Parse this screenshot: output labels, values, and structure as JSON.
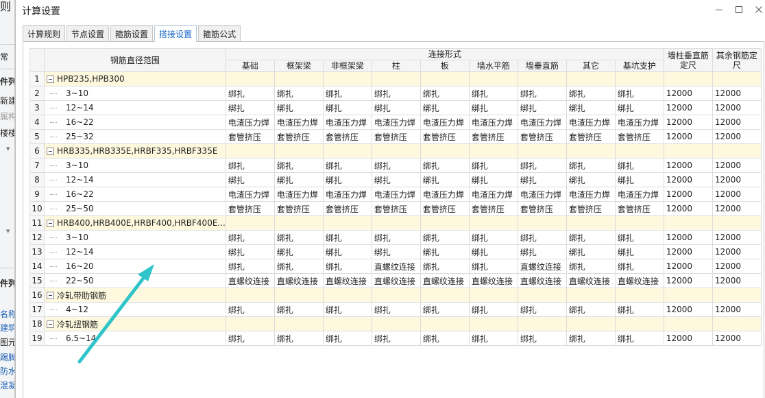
{
  "background_app": {
    "fragments": [
      "则",
      "常",
      "件列",
      "新建",
      "属构件",
      "楼楼",
      "件列",
      "名称",
      "建筑",
      "图元",
      "踢脚",
      "防水",
      "混凝"
    ]
  },
  "dialog": {
    "title": "计算设置",
    "tabs": [
      "计算规则",
      "节点设置",
      "箍筋设置",
      "搭接设置",
      "箍筋公式"
    ],
    "active_tab": "搭接设置"
  },
  "grid": {
    "header": {
      "range_col": "钢筋直径范围",
      "group_header": "连接形式",
      "sub_cols": [
        "基础",
        "框架梁",
        "非框架梁",
        "柱",
        "板",
        "墙水平筋",
        "墙垂直筋",
        "其它",
        "基坑支护"
      ],
      "wall_length": "墙柱垂直筋定尺",
      "other_length": "其余钢筋定尺"
    },
    "rows": [
      {
        "n": "1",
        "type": "group",
        "label": "HPB235,HPB300",
        "cells": [
          "",
          "",
          "",
          "",
          "",
          "",
          "",
          "",
          ""
        ],
        "l1": "",
        "l2": ""
      },
      {
        "n": "2",
        "type": "child",
        "label": "3~10",
        "cells": [
          "绑扎",
          "绑扎",
          "绑扎",
          "绑扎",
          "绑扎",
          "绑扎",
          "绑扎",
          "绑扎",
          "绑扎"
        ],
        "l1": "12000",
        "l2": "12000"
      },
      {
        "n": "3",
        "type": "child",
        "label": "12~14",
        "cells": [
          "绑扎",
          "绑扎",
          "绑扎",
          "绑扎",
          "绑扎",
          "绑扎",
          "绑扎",
          "绑扎",
          "绑扎"
        ],
        "l1": "12000",
        "l2": "12000"
      },
      {
        "n": "4",
        "type": "child",
        "label": "16~22",
        "cells": [
          "电渣压力焊",
          "电渣压力焊",
          "电渣压力焊",
          "电渣压力焊",
          "电渣压力焊",
          "电渣压力焊",
          "电渣压力焊",
          "电渣压力焊",
          "电渣压力焊"
        ],
        "l1": "12000",
        "l2": "12000"
      },
      {
        "n": "5",
        "type": "child",
        "label": "25~32",
        "cells": [
          "套管挤压",
          "套管挤压",
          "套管挤压",
          "套管挤压",
          "套管挤压",
          "套管挤压",
          "套管挤压",
          "套管挤压",
          "套管挤压"
        ],
        "l1": "12000",
        "l2": "12000"
      },
      {
        "n": "6",
        "type": "group",
        "label": "HRB335,HRB335E,HRBF335,HRBF335E",
        "cells": [
          "",
          "",
          "",
          "",
          "",
          "",
          "",
          "",
          ""
        ],
        "l1": "",
        "l2": ""
      },
      {
        "n": "7",
        "type": "child",
        "label": "3~10",
        "cells": [
          "绑扎",
          "绑扎",
          "绑扎",
          "绑扎",
          "绑扎",
          "绑扎",
          "绑扎",
          "绑扎",
          "绑扎"
        ],
        "l1": "12000",
        "l2": "12000"
      },
      {
        "n": "8",
        "type": "child",
        "label": "12~14",
        "cells": [
          "绑扎",
          "绑扎",
          "绑扎",
          "绑扎",
          "绑扎",
          "绑扎",
          "绑扎",
          "绑扎",
          "绑扎"
        ],
        "l1": "12000",
        "l2": "12000"
      },
      {
        "n": "9",
        "type": "child",
        "label": "16~22",
        "cells": [
          "电渣压力焊",
          "电渣压力焊",
          "电渣压力焊",
          "电渣压力焊",
          "电渣压力焊",
          "电渣压力焊",
          "电渣压力焊",
          "电渣压力焊",
          "电渣压力焊"
        ],
        "l1": "12000",
        "l2": "12000"
      },
      {
        "n": "10",
        "type": "child",
        "label": "25~50",
        "cells": [
          "套管挤压",
          "套管挤压",
          "套管挤压",
          "套管挤压",
          "套管挤压",
          "套管挤压",
          "套管挤压",
          "套管挤压",
          "套管挤压"
        ],
        "l1": "12000",
        "l2": "12000"
      },
      {
        "n": "11",
        "type": "group",
        "label": "HRB400,HRB400E,HRBF400,HRBF400E...",
        "cells": [
          "",
          "",
          "",
          "",
          "",
          "",
          "",
          "",
          ""
        ],
        "l1": "",
        "l2": ""
      },
      {
        "n": "12",
        "type": "child",
        "label": "3~10",
        "cells": [
          "绑扎",
          "绑扎",
          "绑扎",
          "绑扎",
          "绑扎",
          "绑扎",
          "绑扎",
          "绑扎",
          "绑扎"
        ],
        "l1": "12000",
        "l2": "12000"
      },
      {
        "n": "13",
        "type": "child",
        "label": "12~14",
        "cells": [
          "绑扎",
          "绑扎",
          "绑扎",
          "绑扎",
          "绑扎",
          "绑扎",
          "绑扎",
          "绑扎",
          "绑扎"
        ],
        "l1": "12000",
        "l2": "12000"
      },
      {
        "n": "14",
        "type": "child",
        "label": "16~20",
        "cells": [
          "绑扎",
          "绑扎",
          "绑扎",
          "直螺纹连接",
          "绑扎",
          "绑扎",
          "直螺纹连接",
          "绑扎",
          "绑扎"
        ],
        "l1": "12000",
        "l2": "12000"
      },
      {
        "n": "15",
        "type": "child",
        "label": "22~50",
        "cells": [
          "直螺纹连接",
          "直螺纹连接",
          "直螺纹连接",
          "直螺纹连接",
          "直螺纹连接",
          "直螺纹连接",
          "直螺纹连接",
          "直螺纹连接",
          "直螺纹连接"
        ],
        "l1": "12000",
        "l2": "12000"
      },
      {
        "n": "16",
        "type": "group",
        "label": "冷轧带肋钢筋",
        "cells": [
          "",
          "",
          "",
          "",
          "",
          "",
          "",
          "",
          ""
        ],
        "l1": "",
        "l2": ""
      },
      {
        "n": "17",
        "type": "child",
        "label": "4~12",
        "cells": [
          "绑扎",
          "绑扎",
          "绑扎",
          "绑扎",
          "绑扎",
          "绑扎",
          "绑扎",
          "绑扎",
          "绑扎"
        ],
        "l1": "12000",
        "l2": "12000"
      },
      {
        "n": "18",
        "type": "group",
        "label": "冷轧扭钢筋",
        "cells": [
          "",
          "",
          "",
          "",
          "",
          "",
          "",
          "",
          ""
        ],
        "l1": "",
        "l2": ""
      },
      {
        "n": "19",
        "type": "child",
        "label": "6.5~14",
        "cells": [
          "绑扎",
          "绑扎",
          "绑扎",
          "绑扎",
          "绑扎",
          "绑扎",
          "绑扎",
          "绑扎",
          "绑扎"
        ],
        "l1": "12000",
        "l2": "12000"
      }
    ]
  },
  "annotation": {
    "color": "#2ec4c9"
  }
}
